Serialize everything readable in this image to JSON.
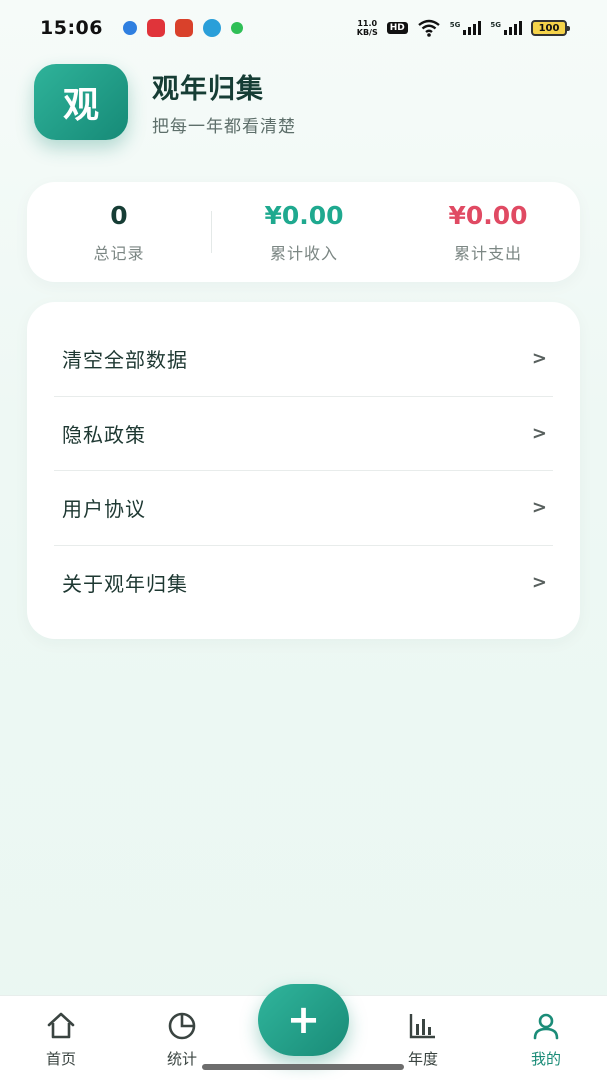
{
  "status_bar": {
    "time": "15:06",
    "net_speed_value": "11.0",
    "net_speed_unit": "KB/S",
    "hd_badge": "HD",
    "signal_1_label": "5G",
    "signal_2_label": "5G",
    "battery": "100",
    "notification_apps": [
      {
        "name": "app-blue-icon",
        "color": "#2f7fe0"
      },
      {
        "name": "app-red-icon-1",
        "color": "#e0343a"
      },
      {
        "name": "app-red-icon-2",
        "color": "#d9412b"
      },
      {
        "name": "telegram-icon",
        "color": "#2a9fd9"
      },
      {
        "name": "wechat-icon",
        "color": "#2fbf56"
      }
    ]
  },
  "header": {
    "logo_char": "观",
    "title": "观年归集",
    "subtitle": "把每一年都看清楚"
  },
  "stats": {
    "total_records": {
      "value": "0",
      "label": "总记录",
      "color": "#163d35"
    },
    "income": {
      "value": "¥0.00",
      "label": "累计收入",
      "color": "#1fa98f"
    },
    "expense": {
      "value": "¥0.00",
      "label": "累计支出",
      "color": "#e04a63"
    }
  },
  "menu": {
    "items": [
      {
        "label": "清空全部数据",
        "chevron": ">"
      },
      {
        "label": "隐私政策",
        "chevron": ">"
      },
      {
        "label": "用户协议",
        "chevron": ">"
      },
      {
        "label": "关于观年归集",
        "chevron": ">"
      }
    ]
  },
  "bottom_nav": {
    "items": [
      {
        "label": "首页",
        "icon": "home-icon"
      },
      {
        "label": "统计",
        "icon": "pie-chart-icon"
      },
      {
        "label": "年度",
        "icon": "bar-chart-icon"
      },
      {
        "label": "我的",
        "icon": "user-icon",
        "active": true
      }
    ],
    "fab_label": "+"
  },
  "colors": {
    "accent": "#1b8c78",
    "income": "#1fa98f",
    "expense": "#e04a63"
  }
}
